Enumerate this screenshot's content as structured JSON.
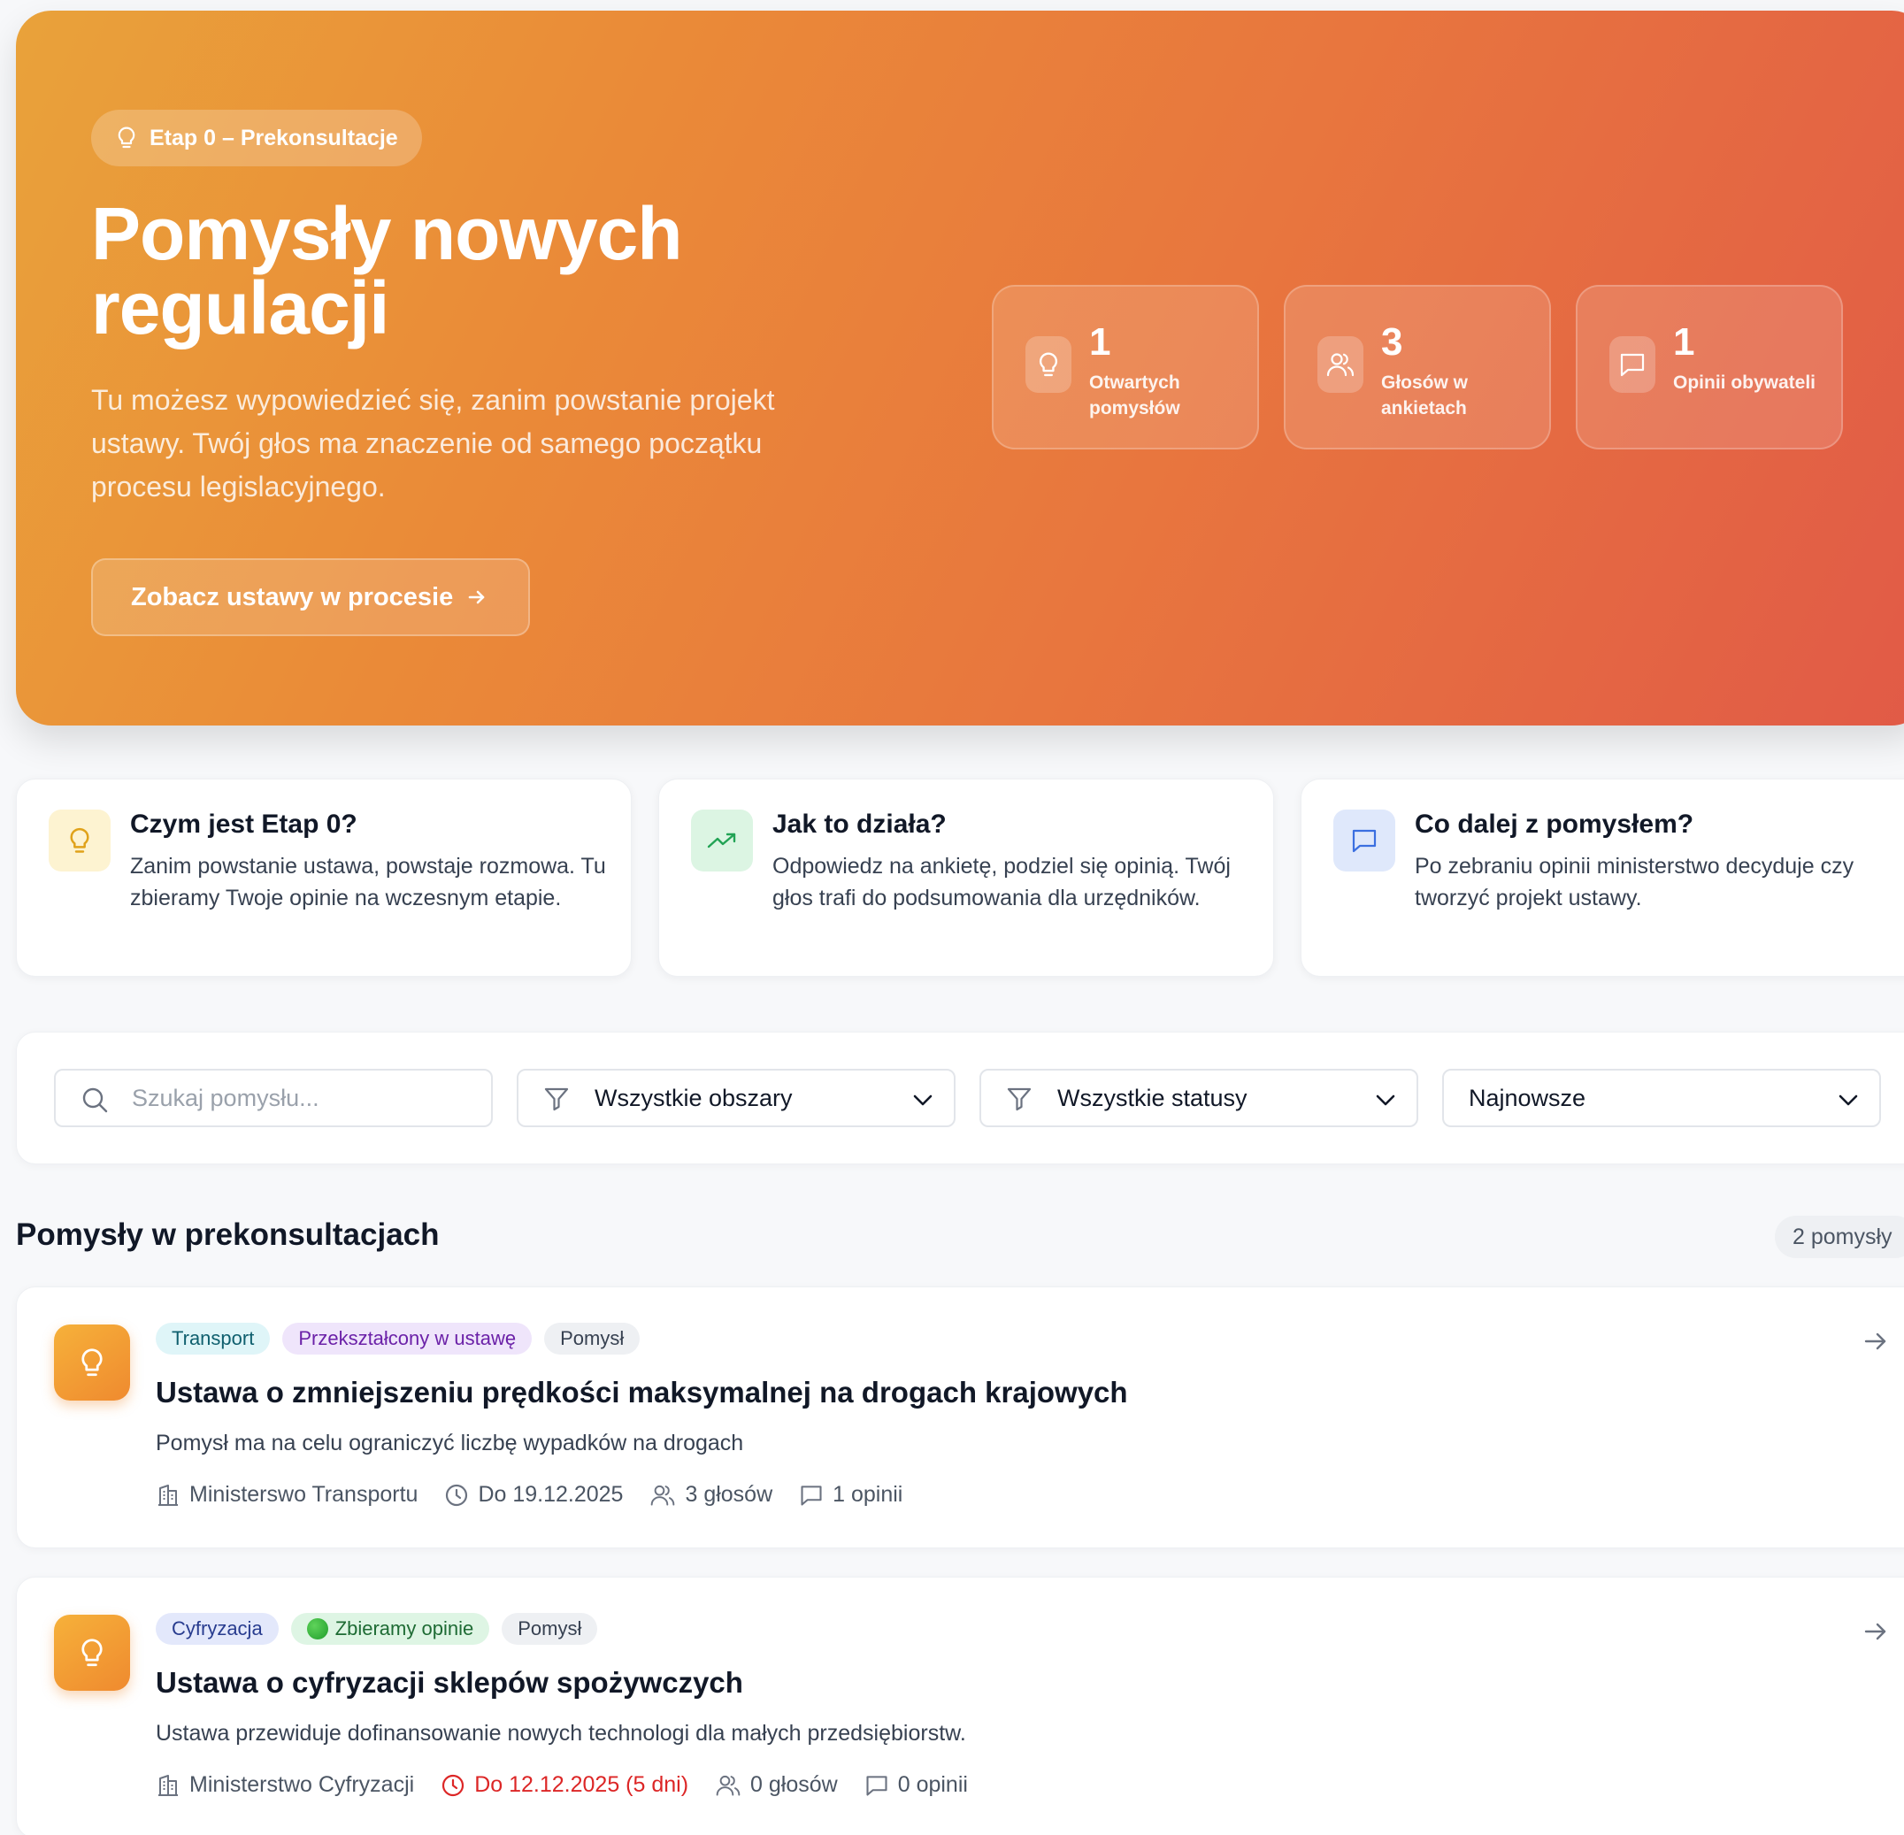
{
  "hero": {
    "stage_badge": "Etap 0 – Prekonsultacje",
    "title_line1": "Pomysły nowych",
    "title_line2": "regulacji",
    "description": "Tu możesz wypowiedzieć się, zanim powstanie projekt ustawy. Twój głos ma znaczenie od samego początku procesu legislacyjnego.",
    "cta_label": "Zobacz ustawy w procesie",
    "stats": [
      {
        "value": "1",
        "label": "Otwartych pomysłów",
        "icon": "lightbulb-icon"
      },
      {
        "value": "3",
        "label": "Głosów w ankietach",
        "icon": "users-icon"
      },
      {
        "value": "1",
        "label": "Opinii obywateli",
        "icon": "message-icon"
      }
    ]
  },
  "info_cards": [
    {
      "title": "Czym jest Etap 0?",
      "text": "Zanim powstanie ustawa, powstaje rozmowa. Tu zbieramy Twoje opinie na wczesnym etapie.",
      "icon": "lightbulb-icon"
    },
    {
      "title": "Jak to działa?",
      "text": "Odpowiedz na ankietę, podziel się opinią. Twój głos trafi do podsumowania dla urzędników.",
      "icon": "trending-up-icon"
    },
    {
      "title": "Co dalej z pomysłem?",
      "text": "Po zebraniu opinii ministerstwo decyduje czy tworzyć projekt ustawy.",
      "icon": "message-icon"
    }
  ],
  "filters": {
    "search_placeholder": "Szukaj pomysłu...",
    "area_value": "Wszystkie obszary",
    "status_value": "Wszystkie statusy",
    "sort_value": "Najnowsze"
  },
  "list": {
    "title": "Pomysły w prekonsultacjach",
    "count": "2 pomysły",
    "items": [
      {
        "tags": [
          "Transport",
          "Przekształcony w ustawę",
          "Pomysł"
        ],
        "title": "Ustawa o zmniejszeniu prędkości maksymalnej na drogach krajowych",
        "description": "Pomysł ma na celu ograniczyć liczbę wypadków na drogach",
        "ministry": "Ministerswo Transportu",
        "deadline": "Do 19.12.2025",
        "votes": "3 głosów",
        "opinions": "1 opinii"
      },
      {
        "tags": [
          "Cyfryzacja",
          "Zbieramy opinie",
          "Pomysł"
        ],
        "title": "Ustawa o cyfryzacji sklepów spożywczych",
        "description": "Ustawa przewiduje dofinansowanie nowych technologi dla małych przedsiębiorstw.",
        "ministry": "Ministerstwo Cyfryzacji",
        "deadline": "Do 12.12.2025 (5 dni)",
        "votes": "0 głosów",
        "opinions": "0 opinii"
      }
    ]
  },
  "colors": {
    "hero_gradient_start": "#e9a23a",
    "hero_gradient_end": "#e15a47",
    "urgent": "#dc2626",
    "accent_orange": "#ef8a2f"
  }
}
